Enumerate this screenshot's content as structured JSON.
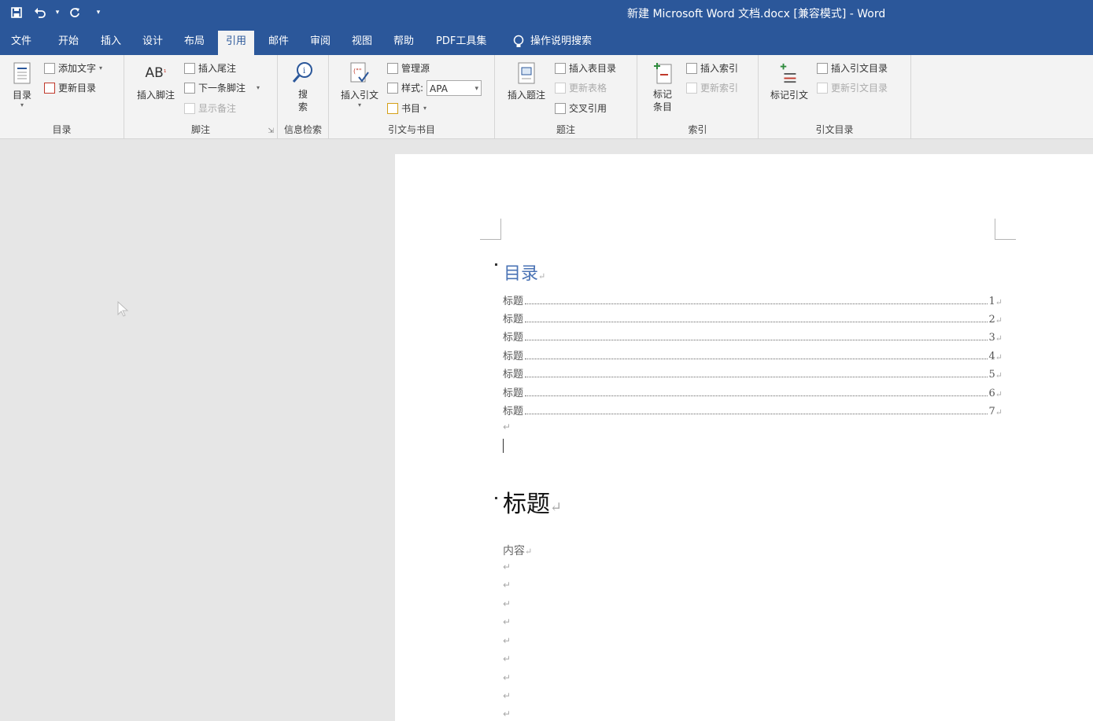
{
  "window": {
    "title": "新建 Microsoft Word 文档.docx [兼容模式]  -  Word"
  },
  "qat": {
    "save_icon": "save-icon",
    "undo_icon": "undo-icon",
    "redo_icon": "redo-icon"
  },
  "tabs": [
    "文件",
    "开始",
    "插入",
    "设计",
    "布局",
    "引用",
    "邮件",
    "审阅",
    "视图",
    "帮助",
    "PDF工具集"
  ],
  "active_tab": "引用",
  "tell_me": "操作说明搜索",
  "ribbon": {
    "toc": {
      "label": "目录",
      "big": "目录",
      "add_text": "添加文字",
      "update": "更新目录"
    },
    "footnote": {
      "label": "脚注",
      "insert_footnote": "插入脚注",
      "insert_endnote": "插入尾注",
      "next_footnote": "下一条脚注",
      "show_notes": "显示备注",
      "big_icon_text": "AB"
    },
    "research": {
      "label": "信息检索",
      "search": "搜索"
    },
    "citations": {
      "label": "引文与书目",
      "insert_citation": "插入引文",
      "manage_sources": "管理源",
      "style_label": "样式:",
      "style_value": "APA",
      "bibliography": "书目"
    },
    "captions": {
      "label": "题注",
      "insert_caption": "插入题注",
      "insert_table_of_figures": "插入表目录",
      "update_table": "更新表格",
      "cross_reference": "交叉引用"
    },
    "index": {
      "label": "索引",
      "mark_entry": "标记条目",
      "insert_index": "插入索引",
      "update_index": "更新索引"
    },
    "authorities": {
      "label": "引文目录",
      "mark_citation": "标记引文",
      "insert_toa": "插入引文目录",
      "update_toa": "更新引文目录"
    }
  },
  "document": {
    "toc_title": "目录",
    "toc_entries": [
      {
        "text": "标题",
        "page": "1"
      },
      {
        "text": "标题",
        "page": "2"
      },
      {
        "text": "标题",
        "page": "3"
      },
      {
        "text": "标题",
        "page": "4"
      },
      {
        "text": "标题",
        "page": "5"
      },
      {
        "text": "标题",
        "page": "6"
      },
      {
        "text": "标题",
        "page": "7"
      }
    ],
    "heading": "标题",
    "body": "内容",
    "para_mark": "↵"
  }
}
